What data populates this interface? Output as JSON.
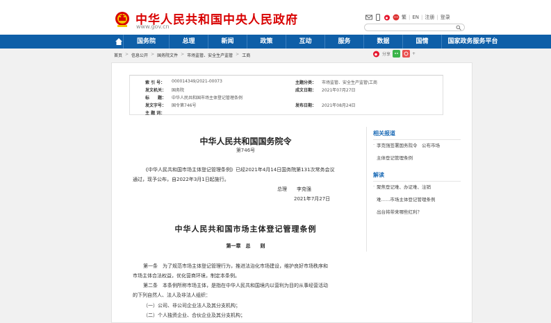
{
  "header": {
    "site_title": "中华人民共和国中央人民政府",
    "site_url": "www.gov.cn",
    "top_links": {
      "traditional": "繁",
      "english_short": "EN",
      "login_hint": "注册",
      "login": "登录",
      "sep": "|"
    },
    "search_placeholder": ""
  },
  "nav": [
    {
      "label": "国务院",
      "w": 66
    },
    {
      "label": "总理",
      "w": 56
    },
    {
      "label": "新闻",
      "w": 56
    },
    {
      "label": "政策",
      "w": 56
    },
    {
      "label": "互动",
      "w": 56
    },
    {
      "label": "服务",
      "w": 56
    },
    {
      "label": "数据",
      "w": 56
    },
    {
      "label": "国情",
      "w": 56
    },
    {
      "label": "国家政务服务平台",
      "w": 90
    }
  ],
  "breadcrumb": [
    "首页",
    "信息公开",
    "国务院文件",
    "市场监管、安全生产监管",
    "工商"
  ],
  "share": {
    "label": "分享"
  },
  "meta": {
    "index_label": "索 引 号：",
    "index_value": "000014349/2021-00073",
    "category_label": "主题分类：",
    "category_value": "市场监管、安全生产监管\\工商",
    "issuer_label": "发文机关：",
    "issuer_value": "国务院",
    "date_written_label": "成文日期：",
    "date_written_value": "2021年07月27日",
    "title_label": "标　　题：",
    "title_value": "中华人民共和国市场主体登记管理条例",
    "doc_no_label": "发文字号：",
    "doc_no_value": "国令第746号",
    "pub_date_label": "发布日期：",
    "pub_date_value": "2021年08月24日",
    "subject_label": "主 题 词："
  },
  "article": {
    "order_title": "中华人民共和国国务院令",
    "order_no": "第746号",
    "intro_line1": "《中华人民共和国市场主体登记管理条例》已经2021年4月14日国务院第131次常务会议",
    "intro_line2": "通过，现予公布，自2022年3月1日起施行。",
    "premier": "总理　　李克强",
    "date": "2021年7月27日",
    "reg_title": "中华人民共和国市场主体登记管理条例",
    "chapter": "第一章　总　　则",
    "art1_line1": "第一条　为了规范市场主体登记管理行为，推进法治化市场建设，维护良好市场秩序和",
    "art1_line2": "市场主体合法权益，优化营商环境，制定本条例。",
    "art2_line1": "第二条　本条例所称市场主体，是指在中华人民共和国境内以营利为目的从事经营活动",
    "art2_line2": "的下列自然人、法人及非法人组织：",
    "item1": "（一）公司、非公司企业法人及其分支机构；",
    "item2": "（二）个人独资企业、合伙企业及其分支机构；"
  },
  "sidebar": {
    "related_heading": "相关报道",
    "related_line1": "李克强签署国务院令　公布市场",
    "related_line2": "主体登记管理条例",
    "analysis_heading": "解读",
    "analysis_line1": "聚焦登记难、办证难、注销",
    "analysis_line2": "难……市场主体登记管理条例",
    "analysis_line3": "出台将带来哪些红利？"
  },
  "colors": {
    "brand_red": "#d80000",
    "nav_blue": "#0f5fa8",
    "link_blue": "#1f6db7"
  }
}
